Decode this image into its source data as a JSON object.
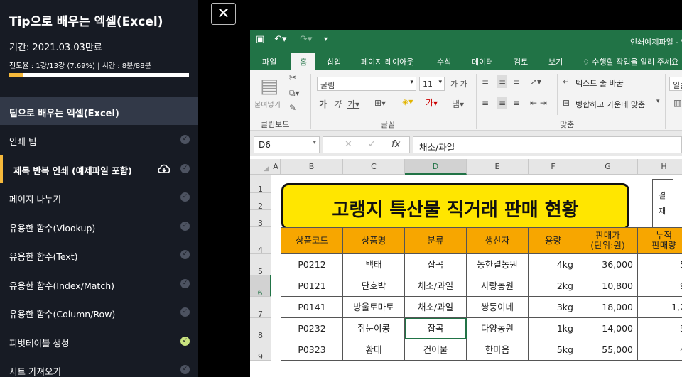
{
  "course": {
    "title": "Tip으로 배우는 엑셀(Excel)",
    "period": "기간: 2021.03.03만료",
    "progress_text": "진도율 : 1강/13강 (7.69%) | 시간 : 8분/88분",
    "progress_fraction": 0.0769
  },
  "section": {
    "title": "팁으로 배우는 엑셀(Excel)"
  },
  "lessons": [
    {
      "label": "인쇄 팁",
      "done": false
    },
    {
      "label": "제목 반복 인쇄 (예제파일 포함)",
      "done": false,
      "current": true
    },
    {
      "label": "페이지 나누기",
      "done": false
    },
    {
      "label": "유용한 함수(Vlookup)",
      "done": false
    },
    {
      "label": "유용한 함수(Text)",
      "done": false
    },
    {
      "label": "유용한 함수(Index/Match)",
      "done": false
    },
    {
      "label": "유용한 함수(Column/Row)",
      "done": false
    },
    {
      "label": "피벗테이블 생성",
      "done": true
    },
    {
      "label": "시트 가져오기",
      "done": false
    }
  ],
  "close_label": "✕",
  "excel": {
    "file_title": "인쇄예제파일 - 엑셀",
    "tabs": [
      "파일",
      "홈",
      "삽입",
      "페이지 레이아웃",
      "수식",
      "데이터",
      "검토",
      "보기"
    ],
    "active_tab": "홈",
    "tell_me": "수행할 작업을 알려 주세요",
    "ribbon": {
      "paste": "붙여넣기",
      "clipboard": "클립보드",
      "font_name": "굴림",
      "font_size": "11",
      "font_group": "글꼴",
      "wrap_text": "텍스트 줄 바꿈",
      "merge_center": "병합하고 가운데 맞춤",
      "align_group": "맞춤",
      "number_fmt": "일반"
    },
    "name_box": "D6",
    "formula": "채소/과일",
    "columns": [
      "A",
      "B",
      "C",
      "D",
      "E",
      "F",
      "G",
      "H"
    ],
    "rows": [
      "1",
      "2",
      "3",
      "4",
      "5",
      "6",
      "7",
      "8",
      "9"
    ],
    "sheet_title": "고랭지 특산물 직거래 판매 현황",
    "approval": [
      "결",
      "재"
    ],
    "headers": [
      "상품코드",
      "상품명",
      "분류",
      "생산자",
      "용량",
      "판매가\n(단위:원)",
      "누적\n판매량"
    ],
    "data": [
      [
        "P0212",
        "백태",
        "잡곡",
        "농한결농원",
        "4kg",
        "36,000",
        "5"
      ],
      [
        "P0121",
        "단호박",
        "채소/과일",
        "사랑농원",
        "2kg",
        "10,800",
        "9"
      ],
      [
        "P0141",
        "방울토마토",
        "채소/과일",
        "쌍둥이네",
        "3kg",
        "18,000",
        "1,2"
      ],
      [
        "P0232",
        "쥐눈이콩",
        "잡곡",
        "다양농원",
        "1kg",
        "14,000",
        "3"
      ],
      [
        "P0323",
        "황태",
        "건어물",
        "한마음",
        "5kg",
        "55,000",
        "4"
      ]
    ]
  }
}
